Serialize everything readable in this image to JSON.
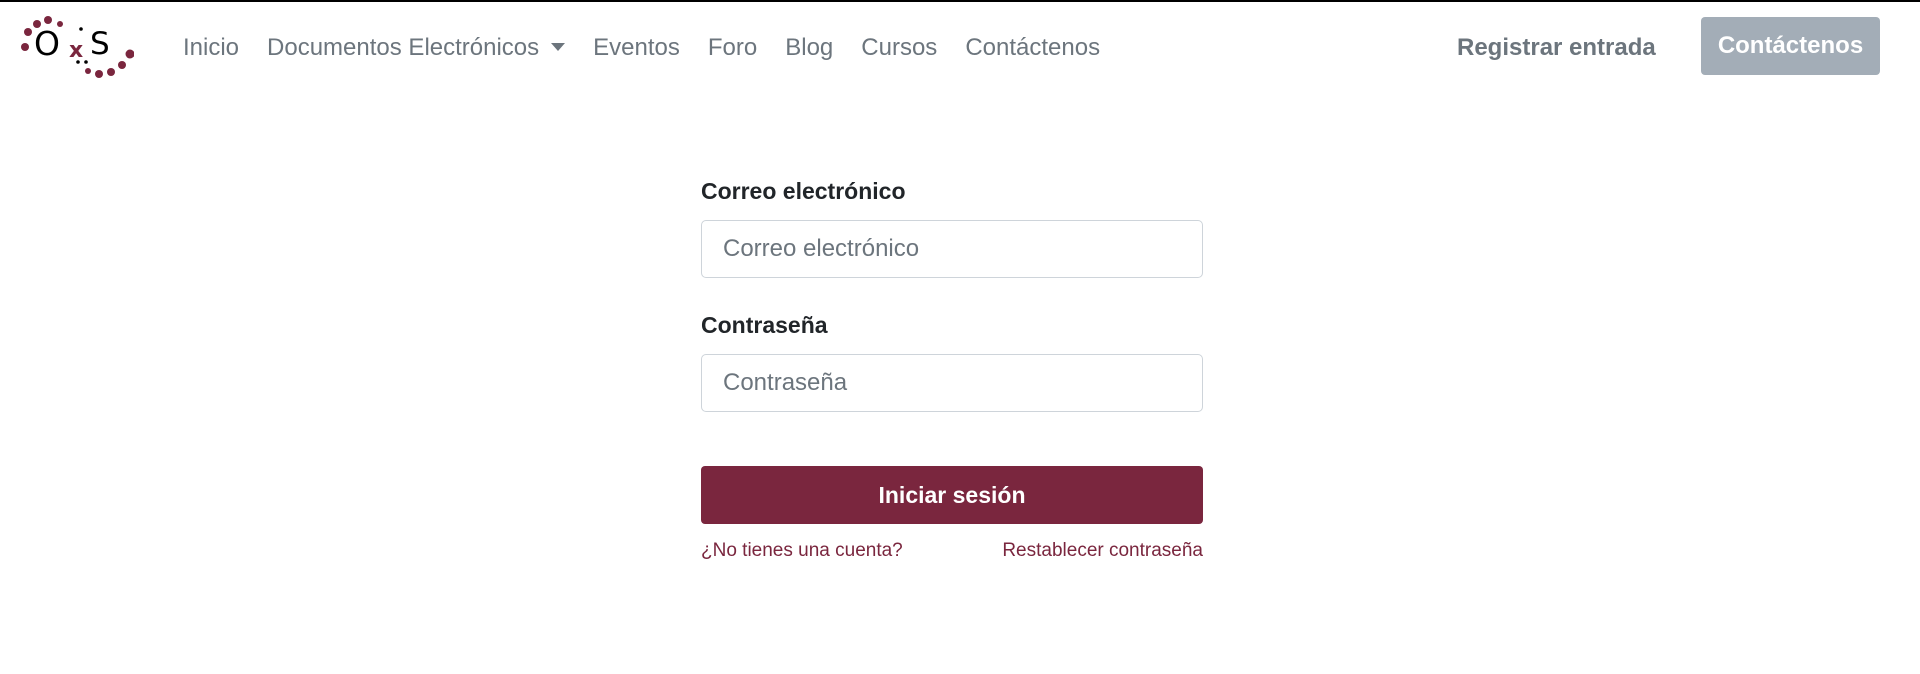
{
  "brand": {
    "logo_text": "OxS",
    "accent_color": "#7a263e",
    "logo_icon": "oxs-logo"
  },
  "nav": {
    "items": [
      "Inicio",
      "Documentos Electrónicos",
      "Eventos",
      "Foro",
      "Blog",
      "Cursos",
      "Contáctenos"
    ],
    "dropdown_indicator": "chevron-down-icon",
    "login_label": "Registrar entrada",
    "contact_button": "Contáctenos",
    "contact_button_color": "#a3adb7"
  },
  "form": {
    "email_label": "Correo electrónico",
    "email_placeholder": "Correo electrónico",
    "email_value": "",
    "password_label": "Contraseña",
    "password_placeholder": "Contraseña",
    "password_value": "",
    "submit_label": "Iniciar sesión",
    "no_account_link": "¿No tienes una cuenta?",
    "reset_link": "Restablecer contraseña"
  }
}
